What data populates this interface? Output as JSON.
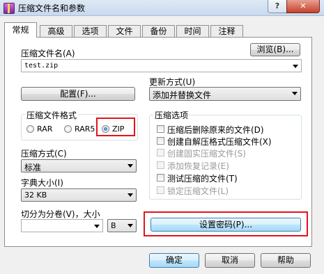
{
  "window": {
    "title": "压缩文件名和参数",
    "help_label": "?",
    "close_label": "✕"
  },
  "tabs": [
    {
      "label": "常规",
      "active": true
    },
    {
      "label": "高级"
    },
    {
      "label": "选项"
    },
    {
      "label": "文件"
    },
    {
      "label": "备份"
    },
    {
      "label": "时间"
    },
    {
      "label": "注释"
    }
  ],
  "archive_name": {
    "label": "压缩文件名(A)",
    "value": "test.zip",
    "browse_label": "浏览(B)..."
  },
  "update_mode": {
    "label": "更新方式(U)",
    "value": "添加并替换文件"
  },
  "profiles_label": "配置(F)...",
  "archive_format": {
    "label": "压缩文件格式",
    "options": [
      "RAR",
      "RAR5",
      "ZIP"
    ],
    "selected": "ZIP"
  },
  "compression_method": {
    "label": "压缩方式(C)",
    "value": "标准"
  },
  "dictionary_size": {
    "label": "字典大小(I)",
    "value": "32 KB"
  },
  "split_volumes": {
    "label": "切分为分卷(V)，大小",
    "value": "",
    "unit": "B"
  },
  "archiving_options": {
    "label": "压缩选项",
    "items": [
      {
        "label": "压缩后删除原来的文件(D)",
        "checked": false,
        "enabled": true
      },
      {
        "label": "创建自解压格式压缩文件(X)",
        "checked": false,
        "enabled": true
      },
      {
        "label": "创建固实压缩文件(S)",
        "checked": false,
        "enabled": false
      },
      {
        "label": "添加恢复记录(E)",
        "checked": false,
        "enabled": false
      },
      {
        "label": "测试压缩的文件(T)",
        "checked": false,
        "enabled": true
      },
      {
        "label": "锁定压缩文件(L)",
        "checked": false,
        "enabled": false
      }
    ]
  },
  "set_password_label": "设置密码(P)...",
  "buttons": {
    "ok": "确定",
    "cancel": "取消",
    "help": "帮助"
  },
  "colors": {
    "highlight": "#e0141c",
    "titlebar": "#c9d9ee",
    "close_button": "#c7412b"
  }
}
